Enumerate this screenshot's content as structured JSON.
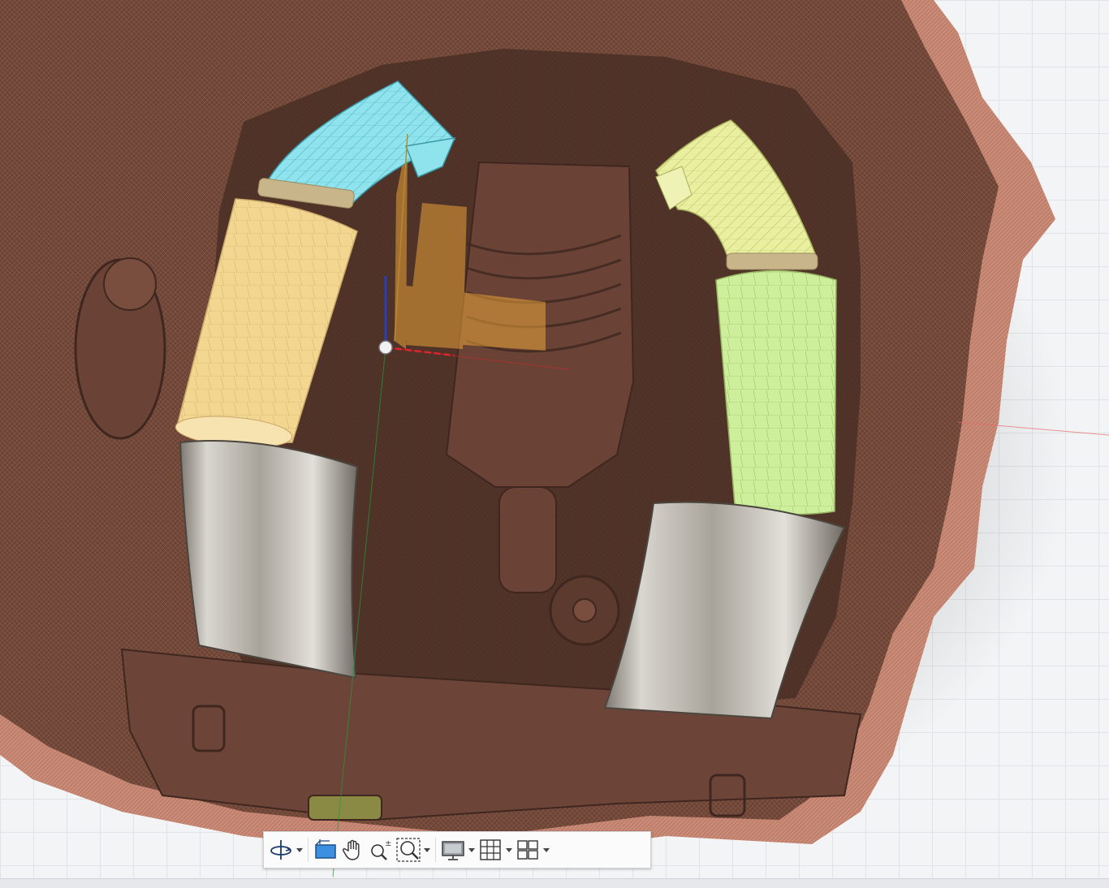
{
  "app": {
    "view": "3D model canvas"
  },
  "colors": {
    "canvas_bg": "#f3f4f6",
    "grid_line": "#e1e3e6",
    "scan_mesh_dark": "#5b3a2e",
    "scan_mesh_mid": "#7a4e3f",
    "scan_mesh_edge": "#c98a76",
    "intake_left_cyan": "#8fe3ec",
    "filter_left_yellow": "#f3d68f",
    "intake_right_yellow": "#e9ef9f",
    "filter_right_green": "#cdee9a",
    "airbox_chrome": "#b9b5ad",
    "selection_orange": "#e8a23a",
    "axis_x": "#e0242a",
    "axis_y": "#1f9d3a",
    "axis_z": "#1f3fd8",
    "toolbar_bg": "#fbfbfb"
  },
  "navigation_toolbar": {
    "buttons": [
      {
        "id": "orbit",
        "icon": "orbit-icon",
        "has_dropdown": true
      },
      {
        "id": "look-at",
        "icon": "look-at-icon",
        "has_dropdown": false
      },
      {
        "id": "pan",
        "icon": "pan-hand-icon",
        "has_dropdown": false
      },
      {
        "id": "zoom",
        "icon": "zoom-icon",
        "has_dropdown": false
      },
      {
        "id": "fit",
        "icon": "zoom-window-icon",
        "has_dropdown": true
      },
      {
        "id": "display-settings",
        "icon": "display-monitor-icon",
        "has_dropdown": true
      },
      {
        "id": "grid-snaps",
        "icon": "grid-icon",
        "has_dropdown": true
      },
      {
        "id": "viewports",
        "icon": "multi-viewport-icon",
        "has_dropdown": true
      }
    ]
  }
}
